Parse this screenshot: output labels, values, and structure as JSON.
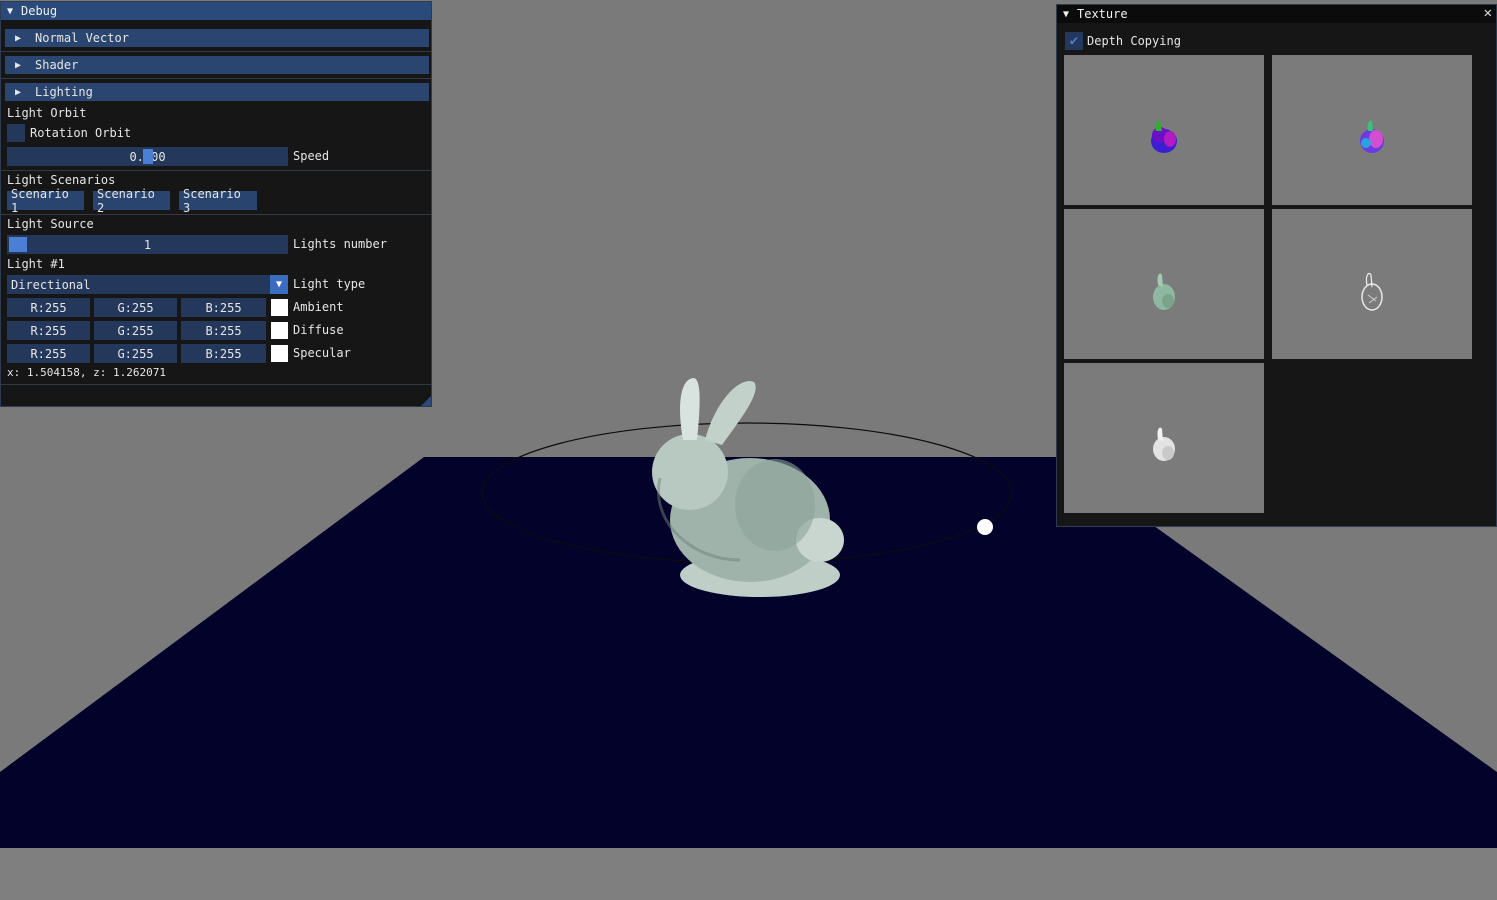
{
  "debug": {
    "title": "Debug",
    "headers": {
      "normal_vector": "Normal Vector",
      "shader": "Shader",
      "lighting": "Lighting"
    },
    "light_orbit": {
      "section": "Light Orbit",
      "rotation_orbit_label": "Rotation Orbit",
      "rotation_orbit_checked": false,
      "speed_value": "0.500",
      "speed_label": "Speed",
      "speed_fraction": 0.5
    },
    "light_scenarios": {
      "section": "Light Scenarios",
      "buttons": [
        "Scenario 1",
        "Scenario 2",
        "Scenario 3"
      ]
    },
    "light_source": {
      "section": "Light Source",
      "lights_number_value": "1",
      "lights_number_label": "Lights number"
    },
    "light1": {
      "section": "Light #1",
      "type_value": "Directional",
      "type_label": "Light type",
      "ambient": {
        "r": "R:255",
        "g": "G:255",
        "b": "B:255",
        "label": "Ambient",
        "swatch": "#ffffff"
      },
      "diffuse": {
        "r": "R:255",
        "g": "G:255",
        "b": "B:255",
        "label": "Diffuse",
        "swatch": "#ffffff"
      },
      "specular": {
        "r": "R:255",
        "g": "G:255",
        "b": "B:255",
        "label": "Specular",
        "swatch": "#ffffff"
      }
    },
    "position_readout": "x: 1.504158, z: 1.262071"
  },
  "texture": {
    "title": "Texture",
    "close_icon": "close-icon",
    "depth_copying_label": "Depth Copying",
    "depth_copying_checked": true
  },
  "colors": {
    "accent": "#4a7fd4",
    "title_active": "#294a7a",
    "floor": "#02022a",
    "background": "#7a7a7a"
  }
}
